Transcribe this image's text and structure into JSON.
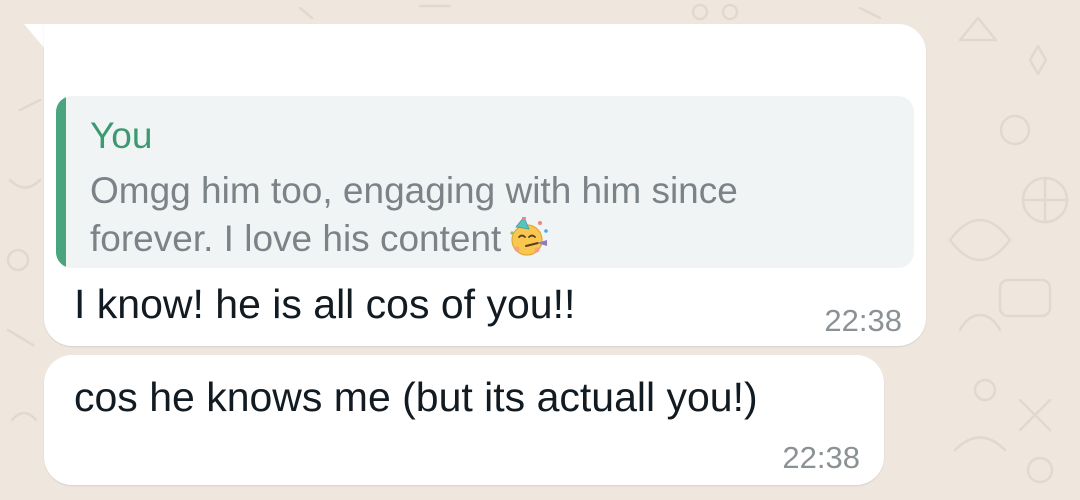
{
  "chat": {
    "messages": [
      {
        "reply_to": {
          "author": "You",
          "text": "Omgg him too, engaging with him since forever. I love his content"
        },
        "text": "I know! he is all cos of you!!",
        "time": "22:38"
      },
      {
        "text": "cos he knows me (but its actuall you!)",
        "time": "22:38"
      }
    ]
  },
  "icons": {
    "reply_emoji": "partying-face-emoji"
  },
  "colors": {
    "wallpaper": "#efe7de",
    "bubble": "#ffffff",
    "quote_background": "#f1f4f4",
    "quote_accent": "#4aa57e",
    "quote_author": "#3c9a72",
    "timestamp": "#8a9296"
  }
}
